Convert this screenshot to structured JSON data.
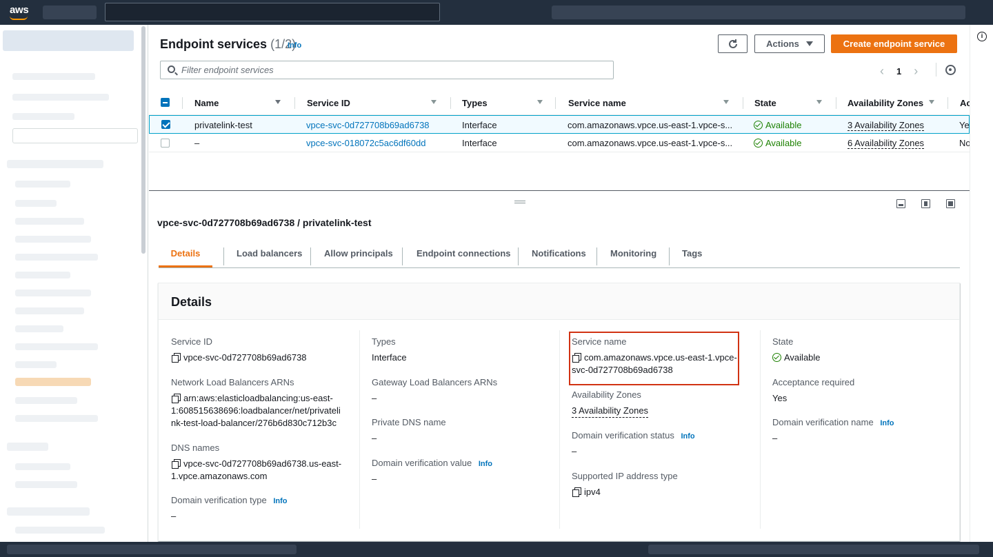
{
  "brand": {
    "logo_text": "aws"
  },
  "page": {
    "title": "Endpoint services",
    "count": "(1/2)",
    "info": "Info",
    "refresh_label": "",
    "actions_label": "Actions",
    "create_label": "Create endpoint service",
    "filter_placeholder": "Filter endpoint services",
    "page_number": "1"
  },
  "table": {
    "columns": [
      "Name",
      "Service ID",
      "Types",
      "Service name",
      "State",
      "Availability Zones",
      "Ac"
    ],
    "rows": [
      {
        "selected": true,
        "name": "privatelink-test",
        "service_id": "vpce-svc-0d727708b69ad6738",
        "types": "Interface",
        "service_name": "com.amazonaws.vpce.us-east-1.vpce-s...",
        "state": "Available",
        "azs": "3 Availability Zones",
        "ac": "Ye"
      },
      {
        "selected": false,
        "name": "–",
        "service_id": "vpce-svc-018072c5ac6df60dd",
        "types": "Interface",
        "service_name": "com.amazonaws.vpce.us-east-1.vpce-s...",
        "state": "Available",
        "azs": "6 Availability Zones",
        "ac": "No"
      }
    ]
  },
  "split": {
    "title": "vpce-svc-0d727708b69ad6738 / privatelink-test",
    "tabs": [
      "Details",
      "Load balancers",
      "Allow principals",
      "Endpoint connections",
      "Notifications",
      "Monitoring",
      "Tags"
    ],
    "details_title": "Details",
    "info": "Info",
    "col1": {
      "service_id_label": "Service ID",
      "service_id": "vpce-svc-0d727708b69ad6738",
      "nlb_label": "Network Load Balancers ARNs",
      "nlb_line1": "arn:aws:elasticloadbalancing:us-east-",
      "nlb_line2": "1:608515638696:loadbalancer/net/privateli",
      "nlb_line3": "nk-test-load-balancer/276b6d830c712b3c",
      "dns_label": "DNS names",
      "dns_line1": "vpce-svc-0d727708b69ad6738.us-east-",
      "dns_line2": "1.vpce.amazonaws.com",
      "dvt_label": "Domain verification type",
      "dvt_value": "–"
    },
    "col2": {
      "types_label": "Types",
      "types_value": "Interface",
      "glb_label": "Gateway Load Balancers ARNs",
      "glb_value": "–",
      "pdns_label": "Private DNS name",
      "pdns_value": "–",
      "dvv_label": "Domain verification value",
      "dvv_value": "–"
    },
    "col3": {
      "sname_label": "Service name",
      "sname_line1": "com.amazonaws.vpce.us-east-1.vpce-",
      "sname_line2": "svc-0d727708b69ad6738",
      "az_label": "Availability Zones",
      "az_value": "3 Availability Zones",
      "dvs_label": "Domain verification status",
      "dvs_value": "–",
      "ip_label": "Supported IP address type",
      "ip_value": "ipv4"
    },
    "col4": {
      "state_label": "State",
      "state_value": "Available",
      "acc_label": "Acceptance required",
      "acc_value": "Yes",
      "dvn_label": "Domain verification name",
      "dvn_value": "–"
    }
  },
  "colors": {
    "accent": "#ec7211",
    "link": "#0073bb",
    "success": "#1d8102",
    "nav_bg": "#232f3e",
    "highlight": "#d13212"
  }
}
